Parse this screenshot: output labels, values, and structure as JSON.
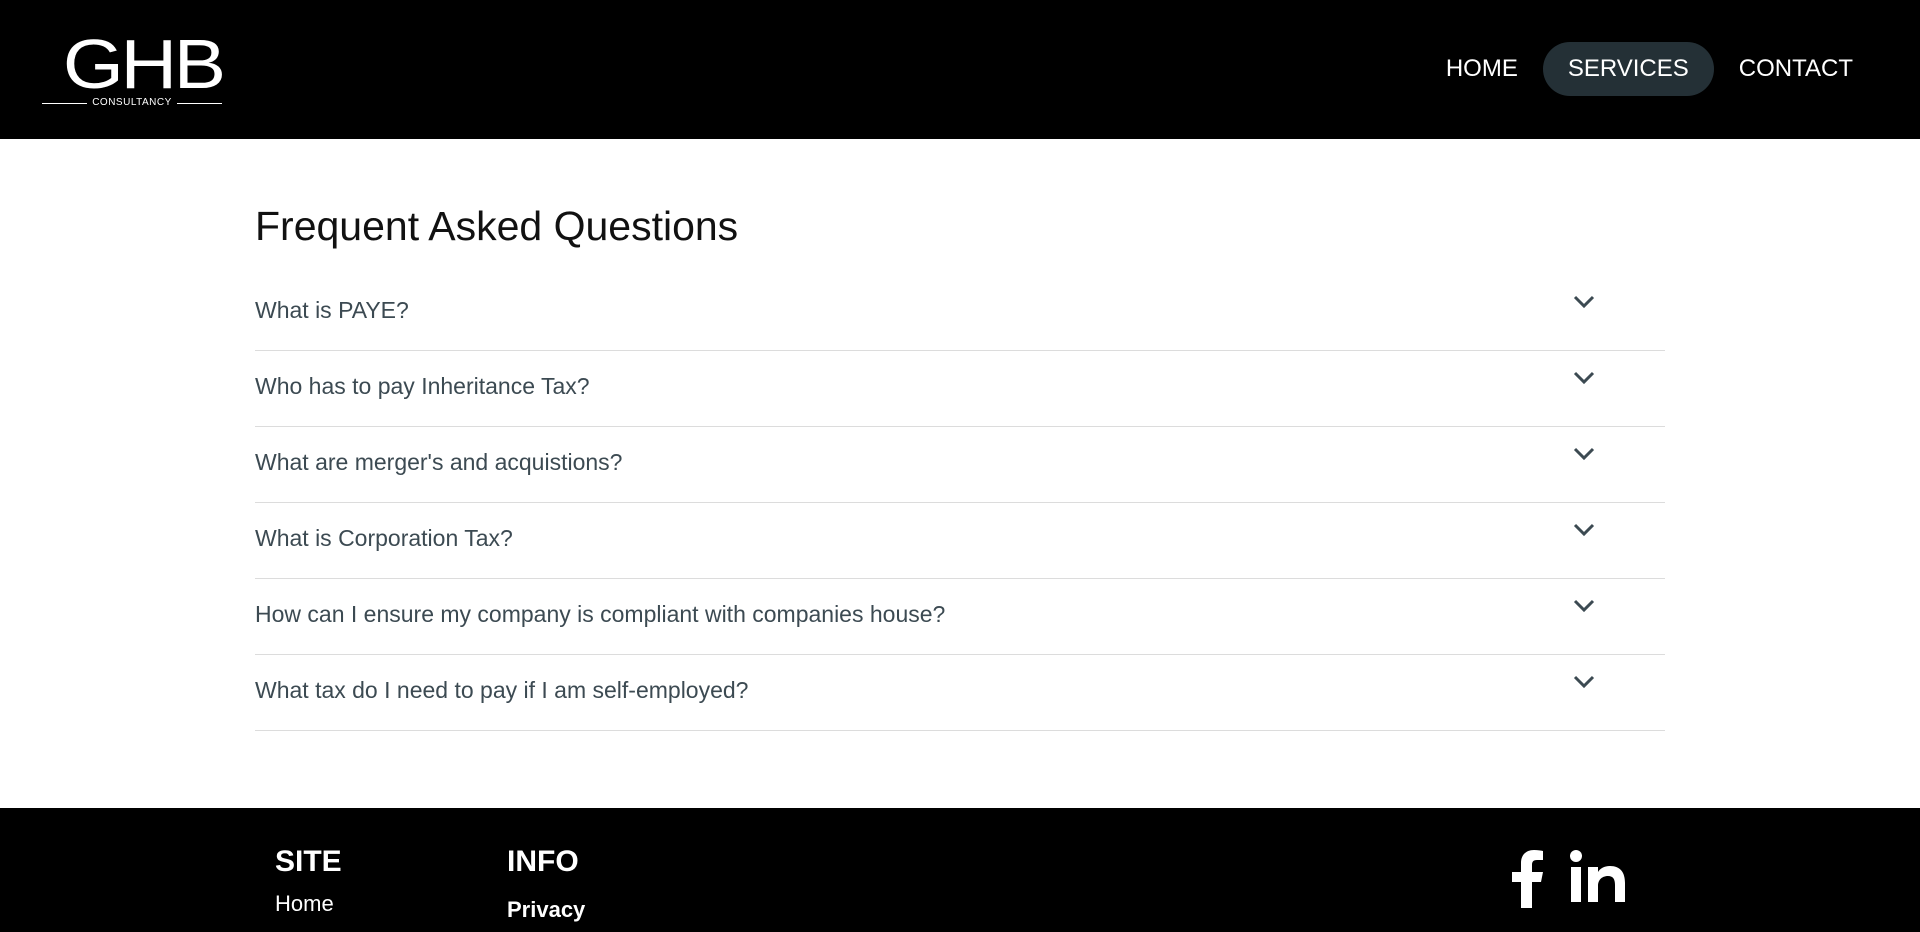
{
  "header": {
    "logo_text": "GHB",
    "logo_sub": "CONSULTANCY",
    "nav": [
      {
        "label": "HOME"
      },
      {
        "label": "SERVICES",
        "active": true
      },
      {
        "label": "CONTACT"
      }
    ]
  },
  "faq": {
    "title": "Frequent Asked Questions",
    "items": [
      {
        "question": "What is PAYE?"
      },
      {
        "question": "Who has to pay Inheritance Tax?"
      },
      {
        "question": "What are merger's and acquistions?"
      },
      {
        "question": "What is Corporation Tax?"
      },
      {
        "question": "How can I ensure my company is compliant with companies house?"
      },
      {
        "question": "What tax do I need to pay if I am self-employed?"
      }
    ],
    "chevron_icon": "chevron-down-icon"
  },
  "footer": {
    "site": {
      "heading": "SITE",
      "links": [
        {
          "label": "Home"
        }
      ]
    },
    "info": {
      "heading": "INFO",
      "links": [
        {
          "label": "Privacy"
        }
      ]
    },
    "social": [
      {
        "icon": "facebook-icon"
      },
      {
        "icon": "linkedin-icon"
      }
    ]
  },
  "colors": {
    "header_bg": "#000000",
    "nav_active_bg": "#243036",
    "question_text": "#3c4a52",
    "divider": "#dcdcdc"
  }
}
